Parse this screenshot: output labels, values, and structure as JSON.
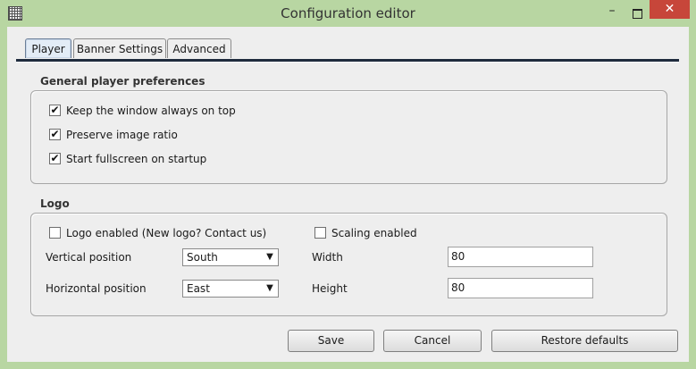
{
  "window": {
    "title": "Configuration editor",
    "min_glyph": "–",
    "close_glyph": "✕"
  },
  "tabs": [
    {
      "label": "Player",
      "active": true
    },
    {
      "label": "Banner Settings",
      "active": false
    },
    {
      "label": "Advanced",
      "active": false
    }
  ],
  "general": {
    "title": "General player preferences",
    "options": [
      {
        "label": "Keep the window always on top",
        "checked": true
      },
      {
        "label": "Preserve image ratio",
        "checked": true
      },
      {
        "label": "Start fullscreen on startup",
        "checked": true
      }
    ]
  },
  "logo": {
    "title": "Logo",
    "logo_enabled": {
      "label": "Logo enabled (New logo? Contact us)",
      "checked": false
    },
    "scaling_enabled": {
      "label": "Scaling enabled",
      "checked": false
    },
    "vertical_position": {
      "label": "Vertical position",
      "value": "South"
    },
    "horizontal_position": {
      "label": "Horizontal position",
      "value": "East"
    },
    "width": {
      "label": "Width",
      "value": "80"
    },
    "height": {
      "label": "Height",
      "value": "80"
    }
  },
  "buttons": {
    "save": "Save",
    "cancel": "Cancel",
    "restore": "Restore defaults"
  },
  "icons": {
    "app": "grid-app-icon",
    "dropdown": "▼",
    "check": "✔"
  }
}
